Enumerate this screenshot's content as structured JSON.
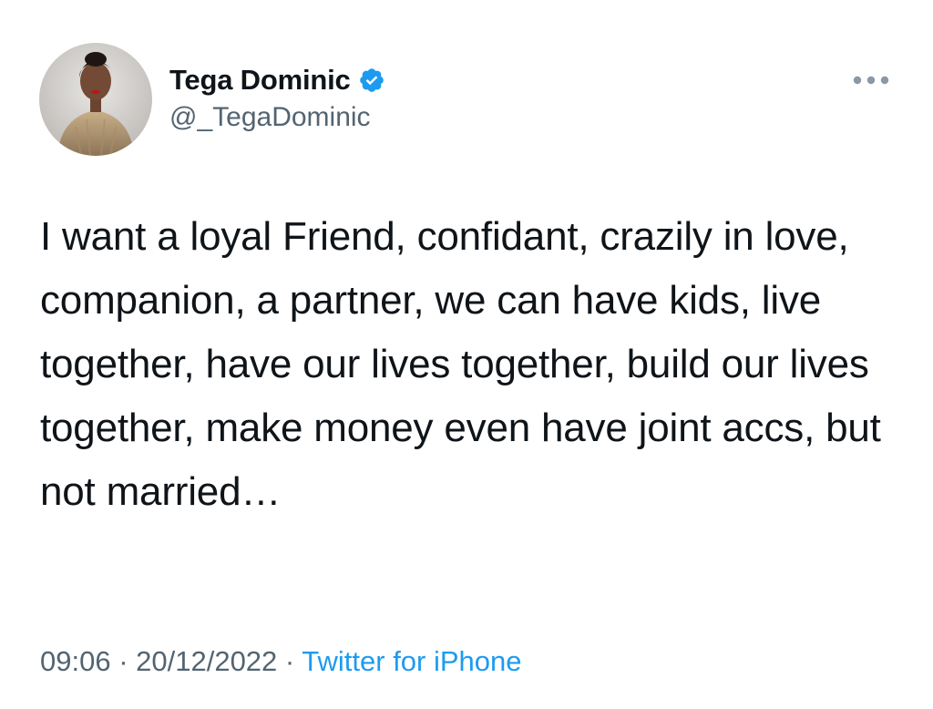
{
  "tweet": {
    "author": {
      "display_name": "Tega Dominic",
      "handle": "@_TegaDominic",
      "verified": true
    },
    "text": "I want a loyal Friend, confidant, crazily in love, companion, a partner, we can have kids, live together, have our lives together, build our lives together, make money even have joint accs, but not married…",
    "time": "09:06",
    "separator": " · ",
    "date": "20/12/2022",
    "source": "Twitter for iPhone"
  },
  "icons": {
    "verified": "verified-badge-icon",
    "more": "more-options-icon"
  },
  "colors": {
    "accent": "#1d9bf0",
    "text_primary": "#0f1419",
    "text_secondary": "#536471",
    "background": "#ffffff"
  }
}
